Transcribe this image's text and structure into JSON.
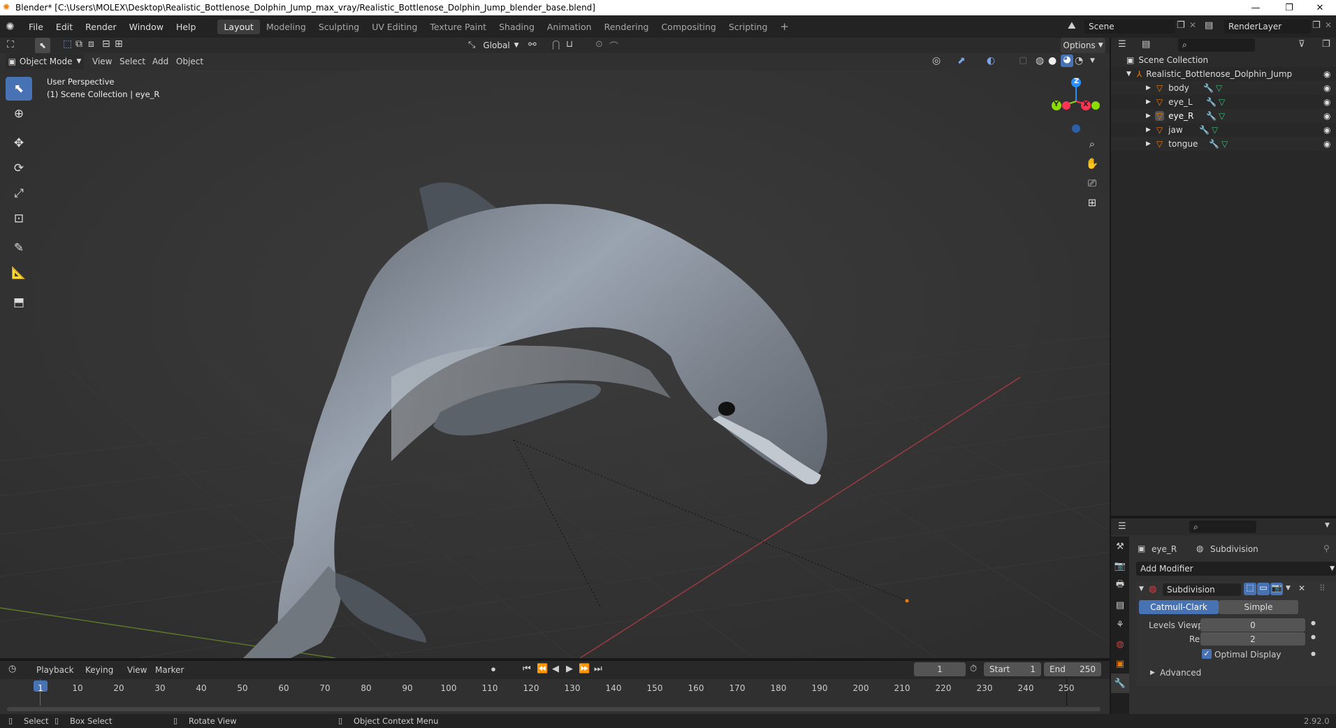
{
  "window": {
    "title": "Blender* [C:\\Users\\MOLEX\\Desktop\\Realistic_Bottlenose_Dolphin_Jump_max_vray/Realistic_Bottlenose_Dolphin_Jump_blender_base.blend]",
    "minimize": "—",
    "maximize": "❐",
    "close": "✕"
  },
  "menu": [
    "File",
    "Edit",
    "Render",
    "Window",
    "Help"
  ],
  "workspaces": [
    "Layout",
    "Modeling",
    "Sculpting",
    "UV Editing",
    "Texture Paint",
    "Shading",
    "Animation",
    "Rendering",
    "Compositing",
    "Scripting"
  ],
  "workspace_add": "+",
  "scene": {
    "label": "Scene",
    "render_layer": "RenderLayer"
  },
  "viewport_header": {
    "mode": "Object Mode",
    "menus": [
      "View",
      "Select",
      "Add",
      "Object"
    ],
    "transform": "Global",
    "options": "Options"
  },
  "viewport": {
    "perspective": "User Perspective",
    "collection": "(1) Scene Collection | eye_R",
    "gizmo": {
      "z": "Z",
      "y": "Y",
      "x": "X"
    }
  },
  "outliner": {
    "root": "Scene Collection",
    "collection": "Realistic_Bottlenose_Dolphin_Jump",
    "objects": [
      "body",
      "eye_L",
      "eye_R",
      "jaw",
      "tongue"
    ]
  },
  "properties": {
    "object": "eye_R",
    "modifier_name": "Subdivision",
    "add_modifier": "Add Modifier",
    "panel_name": "Subdivision",
    "types": [
      "Catmull-Clark",
      "Simple"
    ],
    "levels_viewport_label": "Levels Viewport",
    "levels_viewport": "0",
    "render_label": "Render",
    "render": "2",
    "optimal_display": "Optimal Display",
    "optimal_display_checked": true,
    "advanced": "Advanced"
  },
  "timeline": {
    "menus": [
      "Playback",
      "Keying",
      "View",
      "Marker"
    ],
    "current_frame": "1",
    "start_label": "Start",
    "start": "1",
    "end_label": "End",
    "end": "250",
    "ticks": [
      "1",
      "10",
      "20",
      "30",
      "40",
      "50",
      "60",
      "70",
      "80",
      "90",
      "100",
      "110",
      "120",
      "130",
      "140",
      "150",
      "160",
      "170",
      "180",
      "190",
      "200",
      "210",
      "220",
      "230",
      "240",
      "250"
    ]
  },
  "statusbar": {
    "select": "Select",
    "box_select": "Box Select",
    "rotate_view": "Rotate View",
    "context_menu": "Object Context Menu",
    "version": "2.92.0"
  },
  "colors": {
    "accent": "#4772b3",
    "axis_x": "#ff3352",
    "axis_y": "#8bdc00",
    "axis_z": "#2890ff",
    "object_orange": "#e87d0d",
    "mesh_green": "#3fba7c"
  }
}
